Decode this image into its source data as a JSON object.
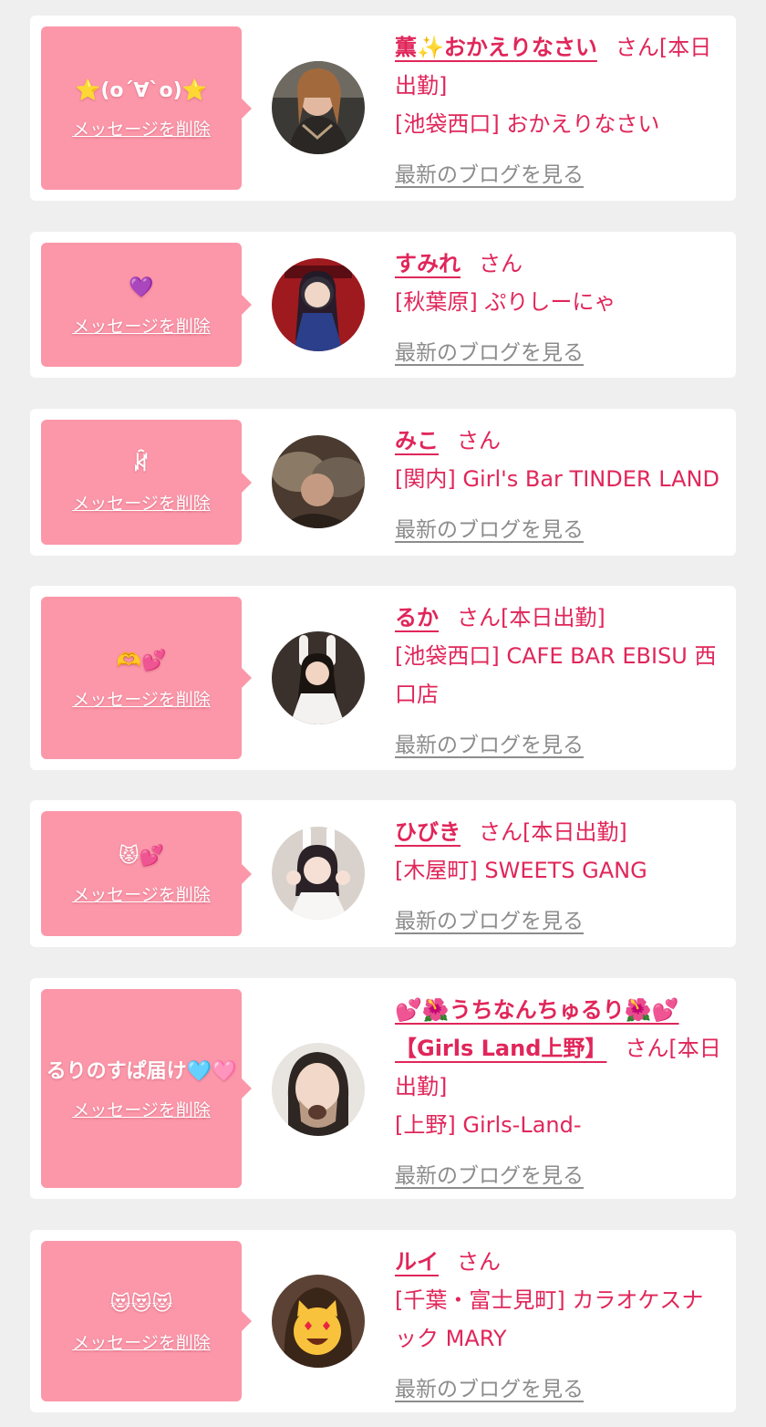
{
  "delete_label": "メッセージを削除",
  "blog_label": "最新のブログを見る",
  "colors": {
    "bubble": "#fb97a9",
    "accent": "#e0265a",
    "muted": "#8c8c8c",
    "page_bg": "#efefef"
  },
  "cards": [
    {
      "message": "⭐(o´∀`o)⭐",
      "name": "薫✨おかえりなさい",
      "suffix": "さん[本日出勤]",
      "shop": "[池袋西口] おかえりなさい",
      "avatar": "avatar-photo-1"
    },
    {
      "message": "💜",
      "name": "すみれ",
      "suffix": "さん",
      "shop": "[秋葉原] ぷりしーにゃ",
      "avatar": "avatar-photo-2"
    },
    {
      "message": "ꊜ",
      "name": "みこ",
      "suffix": "さん",
      "shop": "[関内] Girl's Bar TINDER LAND",
      "avatar": "avatar-photo-3"
    },
    {
      "message": "🫶💕",
      "name": "るか",
      "suffix": "さん[本日出勤]",
      "shop": "[池袋西口] CAFE BAR EBISU 西口店",
      "avatar": "avatar-photo-4"
    },
    {
      "message": "😾💕",
      "name": "ひびき",
      "suffix": "さん[本日出勤]",
      "shop": "[木屋町] SWEETS GANG",
      "avatar": "avatar-photo-5"
    },
    {
      "message": "るりのすぱ届け🩵🩷",
      "name": "💕🌺うちなんちゅるり🌺💕【Girls Land上野】",
      "suffix": "さん[本日出勤]",
      "shop": "[上野] Girls-Land-",
      "avatar": "avatar-photo-6"
    },
    {
      "message": "😻😻😻",
      "name": "ルイ",
      "suffix": "さん",
      "shop": "[千葉・富士見町] カラオケスナック MARY",
      "avatar": "avatar-photo-7"
    }
  ]
}
